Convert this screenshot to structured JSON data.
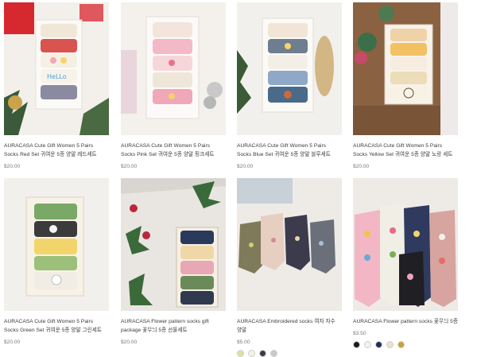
{
  "products": [
    {
      "title": "AURACASA Cute Gift Women 5 Pairs Socks Red Set 귀여운 5종 양말 레드세트",
      "price": "$20.00",
      "image": "red-set-socks-photo"
    },
    {
      "title": "AURACASA Cute Gift Women 5 Pairs Socks Pink Set 귀여운 5종 양말 핑크세트",
      "price": "$20.00",
      "image": "pink-set-socks-photo"
    },
    {
      "title": "AURACASA Cute Gift Women 5 Pairs Socks Blue Set 귀여운 5종 양말 블루세트",
      "price": "$20.00",
      "image": "blue-set-socks-photo"
    },
    {
      "title": "AURACASA Cute Gift Women 5 Pairs Socks Yellow Set 귀여운 5종 양말 노랑 세트",
      "price": "$20.00",
      "image": "yellow-set-socks-photo"
    },
    {
      "title": "AURACASA Cute Gift Women 5 Pairs Socks Green Set 귀여운 5종 양말 그린세트",
      "price": "$20.00",
      "image": "green-set-socks-photo"
    },
    {
      "title": "AURACASA Flower pattern socks gift package 꽃무늬 5종 선물세트",
      "price": "$20.00",
      "image": "flower-gift-package-photo"
    },
    {
      "title": "AURACASA Embroidered socks 여자 자수 양말",
      "price": "$5.00",
      "image": "embroidered-socks-photo",
      "swatches": [
        "#e4e09a",
        "#f4f1e6",
        "#3b3b48",
        "#c9c9c9"
      ]
    },
    {
      "title": "AURACASA Flower pattern socks 꽃무늬 5종",
      "price": "$3.50",
      "image": "flower-pattern-socks-photo",
      "swatches": [
        "#1c1c1c",
        "#f2f2f2",
        "#1f2f5a",
        "#e8e2c8",
        "#c8a23a"
      ]
    }
  ]
}
